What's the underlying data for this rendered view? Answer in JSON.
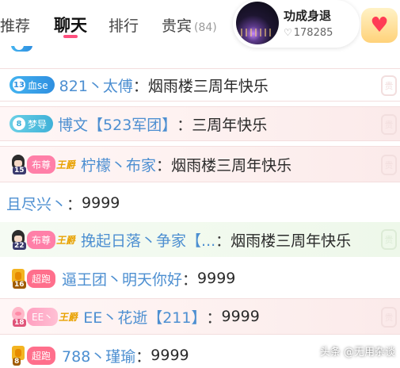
{
  "tabs": [
    {
      "label": "推荐"
    },
    {
      "label": "聊天"
    },
    {
      "label": "排行"
    },
    {
      "label": "贵宾",
      "count": "(84)"
    }
  ],
  "anchor": {
    "name": "功成身退",
    "likes": "178285",
    "likes_icon": "heart-outline-icon"
  },
  "reward_icon": "heart-gift-icon",
  "messages": [
    {
      "nick": "821丶太傅",
      "sep": "：",
      "content": "烟雨楼三周年快乐",
      "badge_num": "13",
      "badge_label": "血se"
    },
    {
      "nick": "博文【523军团】",
      "sep": "：",
      "content": "三周年快乐",
      "badge_num": "8",
      "badge_label": "梦导"
    },
    {
      "nick": "柠檬丶布家",
      "sep": "：",
      "content": "烟雨楼三周年快乐",
      "avatar_level": "15",
      "title": "布尊",
      "king": "王爵"
    },
    {
      "nick": "且尽兴丶",
      "sep": "：",
      "content": "9999"
    },
    {
      "nick": "挽起日落丶争家【...",
      "sep": "：",
      "content": "烟雨楼三周年快乐",
      "avatar_level": "22",
      "title": "布尊",
      "king": "王爵"
    },
    {
      "nick": "逼王团丶明天你好",
      "sep": "：",
      "content": "9999",
      "avatar_level": "16",
      "title": "超跑"
    },
    {
      "nick": "EE丶花逝【211】",
      "sep": "：",
      "content": "9999",
      "avatar_level": "18",
      "title": "EE丶",
      "king": "王爵"
    },
    {
      "nick": "788丶瑾瑜",
      "sep": "：",
      "content": "9999",
      "avatar_level": "8",
      "title": "超跑"
    }
  ],
  "watermark": "头条 @无用杂谈"
}
